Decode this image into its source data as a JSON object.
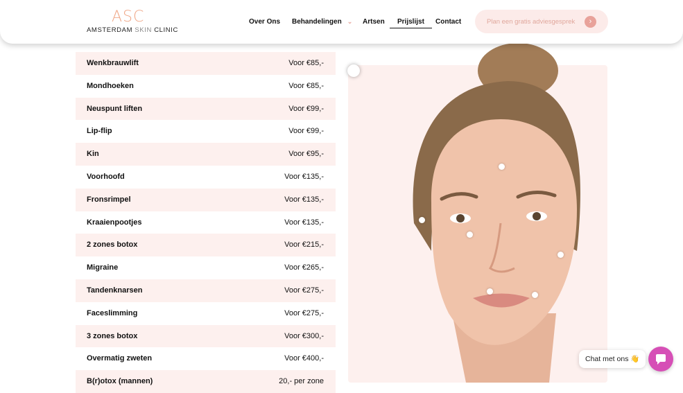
{
  "header": {
    "logo_mark": "ASC",
    "logo_text_1": "AMSTERDAM",
    "logo_text_2": "SKIN",
    "logo_text_3": "CLINIC",
    "nav": [
      {
        "label": "Over Ons"
      },
      {
        "label": "Behandelingen"
      },
      {
        "label": "Artsen"
      },
      {
        "label": "Prijslijst"
      },
      {
        "label": "Contact"
      }
    ],
    "active_nav": "Prijslijst",
    "cta_label": "Plan een gratis adviesgesprek",
    "cta_arrow": "›"
  },
  "prices": [
    {
      "name": "Wenkbrauwlift",
      "price": "Voor €85,-"
    },
    {
      "name": "Mondhoeken",
      "price": "Voor €85,-"
    },
    {
      "name": "Neuspunt liften",
      "price": "Voor €99,-"
    },
    {
      "name": "Lip-flip",
      "price": "Voor €99,-"
    },
    {
      "name": "Kin",
      "price": "Voor €95,-"
    },
    {
      "name": "Voorhoofd",
      "price": "Voor €135,-"
    },
    {
      "name": "Fronsrimpel",
      "price": "Voor €135,-"
    },
    {
      "name": "Kraaienpootjes",
      "price": "Voor €135,-"
    },
    {
      "name": "2 zones botox",
      "price": "Voor €215,-"
    },
    {
      "name": "Migraine",
      "price": "Voor €265,-"
    },
    {
      "name": "Tandenknarsen",
      "price": "Voor €275,-"
    },
    {
      "name": "Faceslimming",
      "price": "Voor €275,-"
    },
    {
      "name": "3 zones botox",
      "price": "Voor €300,-"
    },
    {
      "name": "Overmatig zweten",
      "price": "Voor €400,-"
    },
    {
      "name": "B(r)otox (mannen)",
      "price": "20,- per zone"
    }
  ],
  "chat": {
    "label": "Chat met ons 👋"
  },
  "colors": {
    "accent": "#f0a98a",
    "row_shade": "#fdf0ee",
    "chat_button": "#d64fb6"
  }
}
